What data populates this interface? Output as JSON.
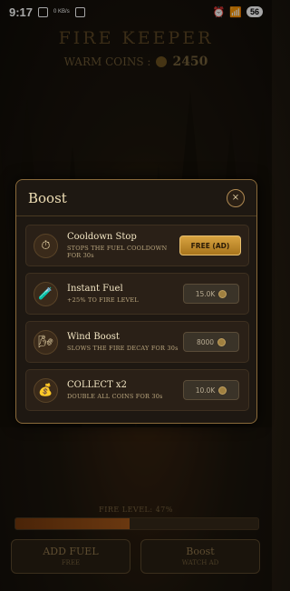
{
  "status": {
    "time": "9:17",
    "net": "0 KB/s",
    "battery": "56"
  },
  "game": {
    "title": "FIRE KEEPER",
    "coins_label": "WARM COINS :",
    "coins_value": "2450",
    "fire_level_label": "FIRE LEVEL: 47%",
    "fire_level": 0.47,
    "add_fuel": {
      "label": "ADD FUEL",
      "sub": "FREE"
    },
    "boost": {
      "label": "Boost",
      "sub": "WATCH AD"
    }
  },
  "modal": {
    "title": "Boost",
    "close_glyph": "×",
    "items": [
      {
        "icon": "stopwatch-icon",
        "glyph": "⏱",
        "name": "Cooldown Stop",
        "desc": "STOPS THE FUEL COOLDOWN FOR 30s",
        "action": "FREE (AD)",
        "type": "free"
      },
      {
        "icon": "fuel-potion-icon",
        "glyph": "🧪",
        "name": "Instant Fuel",
        "desc": "+25% TO FIRE LEVEL",
        "action": "15.0K",
        "type": "cost"
      },
      {
        "icon": "wind-icon",
        "glyph": "🌬",
        "name": "Wind Boost",
        "desc": "SLOWS THE FIRE DECAY FOR 30s",
        "action": "8000",
        "type": "cost"
      },
      {
        "icon": "money-bag-icon",
        "glyph": "💰",
        "name": "COLLECT x2",
        "desc": "DOUBLE ALL COINS FOR 30s",
        "action": "10.0K",
        "type": "cost"
      }
    ]
  },
  "colors": {
    "accent_gold": "#d8a340",
    "modal_border": "#8a6a3a"
  }
}
